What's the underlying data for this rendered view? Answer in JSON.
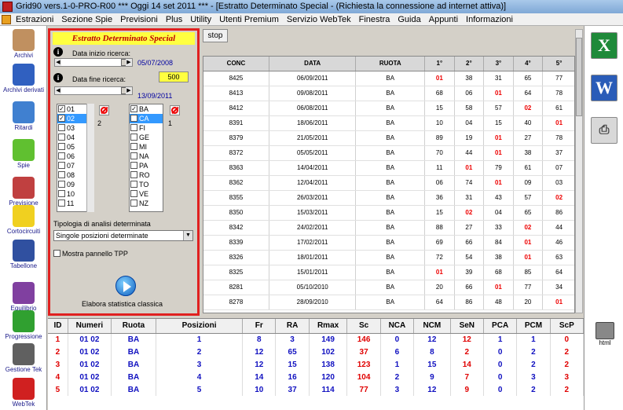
{
  "window": {
    "title": "Grid90 vers.1-0-PRO-R00  ***  Oggi 14 set 2011  ***  - [Estratto Determinato Special - (Richiesta la connessione ad internet attiva)]"
  },
  "menu": [
    "Estrazioni",
    "Sezione Spie",
    "Previsioni",
    "Plus",
    "Utility",
    "Utenti Premium",
    "Servizio WebTek",
    "Finestra",
    "Guida",
    "Appunti",
    "Informazioni"
  ],
  "sidebar": [
    {
      "label": "Archivi",
      "icon": "archive-icon",
      "color": "#c09060"
    },
    {
      "label": "Archivi derivati",
      "icon": "derived-archive-icon",
      "color": "#3060c0"
    },
    {
      "label": "Ritardi",
      "icon": "clock-icon",
      "color": "#4080d0"
    },
    {
      "label": "Spie",
      "icon": "spy-icon",
      "color": "#60c030"
    },
    {
      "label": "Previsione",
      "icon": "checklist-icon",
      "color": "#c04040"
    },
    {
      "label": "Cortocircuiti",
      "icon": "lightbulb-icon",
      "color": "#f0d020"
    },
    {
      "label": "Tabellone",
      "icon": "board-icon",
      "color": "#3050a0"
    },
    {
      "label": "Equilibrio",
      "icon": "scale-icon",
      "color": "#8040a0"
    },
    {
      "label": "Progressione",
      "icon": "dollar-icon",
      "color": "#30a030"
    },
    {
      "label": "Gestione Tek",
      "icon": "calculator-icon",
      "color": "#606060"
    },
    {
      "label": "WebTek",
      "icon": "webtek-icon",
      "color": "#d02020"
    }
  ],
  "rightbar": {
    "html_label": "html"
  },
  "panel": {
    "title": "Estratto Determinato Special",
    "start_label": "Data inizio ricerca:",
    "start_date": "05/07/2008",
    "end_label": "Data fine ricerca:",
    "end_value": "500",
    "end_date": "13/09/2011",
    "numbers": [
      {
        "label": "01",
        "checked": true,
        "selected": false
      },
      {
        "label": "02",
        "checked": true,
        "selected": true
      },
      {
        "label": "03",
        "checked": false,
        "selected": false
      },
      {
        "label": "04",
        "checked": false,
        "selected": false
      },
      {
        "label": "05",
        "checked": false,
        "selected": false
      },
      {
        "label": "06",
        "checked": false,
        "selected": false
      },
      {
        "label": "07",
        "checked": false,
        "selected": false
      },
      {
        "label": "08",
        "checked": false,
        "selected": false
      },
      {
        "label": "09",
        "checked": false,
        "selected": false
      },
      {
        "label": "10",
        "checked": false,
        "selected": false
      },
      {
        "label": "11",
        "checked": false,
        "selected": false
      }
    ],
    "numbers_count": "2",
    "wheels": [
      {
        "label": "BA",
        "checked": true,
        "selected": false
      },
      {
        "label": "CA",
        "checked": false,
        "selected": true
      },
      {
        "label": "FI",
        "checked": false,
        "selected": false
      },
      {
        "label": "GE",
        "checked": false,
        "selected": false
      },
      {
        "label": "MI",
        "checked": false,
        "selected": false
      },
      {
        "label": "NA",
        "checked": false,
        "selected": false
      },
      {
        "label": "PA",
        "checked": false,
        "selected": false
      },
      {
        "label": "RO",
        "checked": false,
        "selected": false
      },
      {
        "label": "TO",
        "checked": false,
        "selected": false
      },
      {
        "label": "VE",
        "checked": false,
        "selected": false
      },
      {
        "label": "NZ",
        "checked": false,
        "selected": false
      }
    ],
    "wheels_count": "1",
    "analysis_label": "Tipologia di analisi determinata",
    "analysis_value": "Singole posizioni determinate",
    "tpp_label": "Mostra pannello TPP",
    "run_label": "Elabora statistica classica"
  },
  "stop_label": "stop",
  "main_table": {
    "headers": [
      "CONC",
      "DATA",
      "RUOTA",
      "1°",
      "2°",
      "3°",
      "4°",
      "5°"
    ],
    "rows": [
      {
        "c": "8425",
        "d": "06/09/2011",
        "r": "BA",
        "n": [
          "01",
          "38",
          "31",
          "65",
          "77"
        ],
        "h": [
          0
        ]
      },
      {
        "c": "8413",
        "d": "09/08/2011",
        "r": "BA",
        "n": [
          "68",
          "06",
          "01",
          "64",
          "78"
        ],
        "h": [
          2
        ]
      },
      {
        "c": "8412",
        "d": "06/08/2011",
        "r": "BA",
        "n": [
          "15",
          "58",
          "57",
          "02",
          "61"
        ],
        "h": [
          3
        ]
      },
      {
        "c": "8391",
        "d": "18/06/2011",
        "r": "BA",
        "n": [
          "10",
          "04",
          "15",
          "40",
          "01"
        ],
        "h": [
          4
        ]
      },
      {
        "c": "8379",
        "d": "21/05/2011",
        "r": "BA",
        "n": [
          "89",
          "19",
          "01",
          "27",
          "78"
        ],
        "h": [
          2
        ]
      },
      {
        "c": "8372",
        "d": "05/05/2011",
        "r": "BA",
        "n": [
          "70",
          "44",
          "01",
          "38",
          "37"
        ],
        "h": [
          2
        ]
      },
      {
        "c": "8363",
        "d": "14/04/2011",
        "r": "BA",
        "n": [
          "11",
          "01",
          "79",
          "61",
          "07"
        ],
        "h": [
          1
        ]
      },
      {
        "c": "8362",
        "d": "12/04/2011",
        "r": "BA",
        "n": [
          "06",
          "74",
          "01",
          "09",
          "03"
        ],
        "h": [
          2
        ]
      },
      {
        "c": "8355",
        "d": "26/03/2011",
        "r": "BA",
        "n": [
          "36",
          "31",
          "43",
          "57",
          "02"
        ],
        "h": [
          4
        ]
      },
      {
        "c": "8350",
        "d": "15/03/2011",
        "r": "BA",
        "n": [
          "15",
          "02",
          "04",
          "65",
          "86"
        ],
        "h": [
          1
        ]
      },
      {
        "c": "8342",
        "d": "24/02/2011",
        "r": "BA",
        "n": [
          "88",
          "27",
          "33",
          "02",
          "44"
        ],
        "h": [
          3
        ]
      },
      {
        "c": "8339",
        "d": "17/02/2011",
        "r": "BA",
        "n": [
          "69",
          "66",
          "84",
          "01",
          "46"
        ],
        "h": [
          3
        ]
      },
      {
        "c": "8326",
        "d": "18/01/2011",
        "r": "BA",
        "n": [
          "72",
          "54",
          "38",
          "01",
          "63"
        ],
        "h": [
          3
        ]
      },
      {
        "c": "8325",
        "d": "15/01/2011",
        "r": "BA",
        "n": [
          "01",
          "39",
          "68",
          "85",
          "64"
        ],
        "h": [
          0
        ]
      },
      {
        "c": "8281",
        "d": "05/10/2010",
        "r": "BA",
        "n": [
          "20",
          "66",
          "01",
          "77",
          "34"
        ],
        "h": [
          2
        ]
      },
      {
        "c": "8278",
        "d": "28/09/2010",
        "r": "BA",
        "n": [
          "64",
          "86",
          "48",
          "20",
          "01"
        ],
        "h": [
          4
        ]
      }
    ]
  },
  "bottom_table": {
    "headers": [
      "ID",
      "Numeri",
      "Ruota",
      "Posizioni",
      "Fr",
      "RA",
      "Rmax",
      "Sc",
      "NCA",
      "NCM",
      "SeN",
      "PCA",
      "PCM",
      "ScP"
    ],
    "rows": [
      [
        "1",
        "01 02",
        "BA",
        "1",
        "8",
        "3",
        "149",
        "146",
        "0",
        "12",
        "12",
        "1",
        "1",
        "0"
      ],
      [
        "2",
        "01 02",
        "BA",
        "2",
        "12",
        "65",
        "102",
        "37",
        "6",
        "8",
        "2",
        "0",
        "2",
        "2"
      ],
      [
        "3",
        "01 02",
        "BA",
        "3",
        "12",
        "15",
        "138",
        "123",
        "1",
        "15",
        "14",
        "0",
        "2",
        "2"
      ],
      [
        "4",
        "01 02",
        "BA",
        "4",
        "14",
        "16",
        "120",
        "104",
        "2",
        "9",
        "7",
        "0",
        "3",
        "3"
      ],
      [
        "5",
        "01 02",
        "BA",
        "5",
        "10",
        "37",
        "114",
        "77",
        "3",
        "12",
        "9",
        "0",
        "2",
        "2"
      ]
    ]
  }
}
